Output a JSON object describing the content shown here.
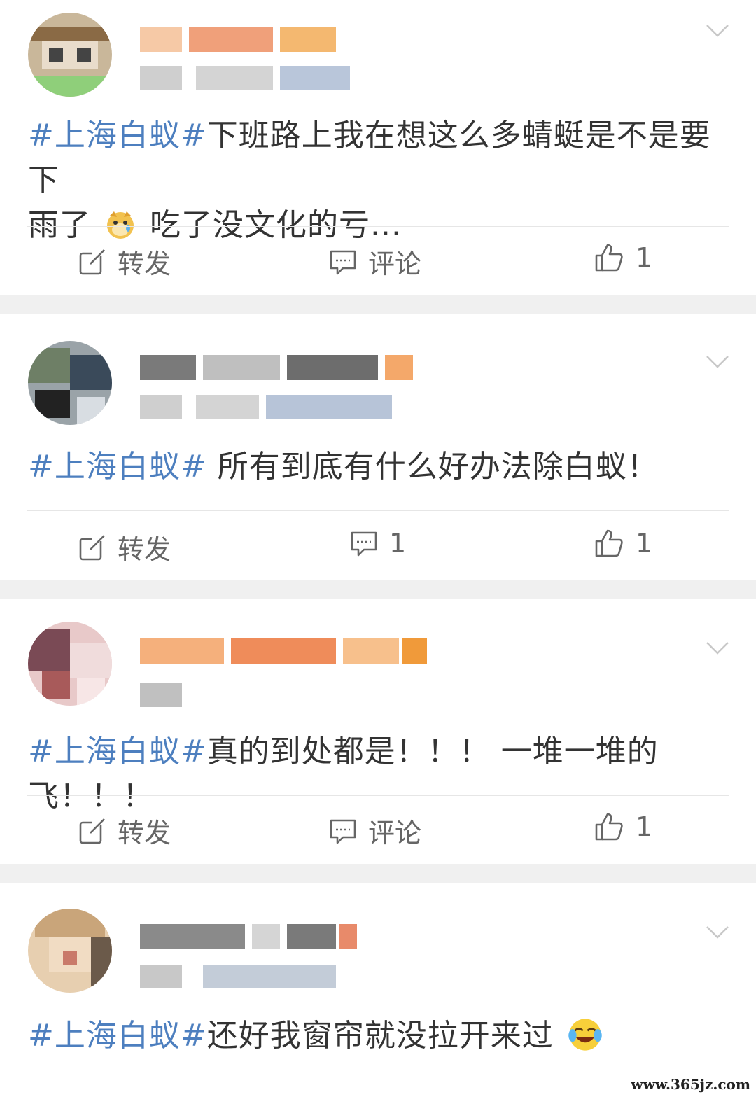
{
  "posts": [
    {
      "topic": "#上海白蚁#",
      "text_line1": "下班路上我在想这么多蜻蜓是不是要下",
      "text_line2_a": "雨了",
      "text_line2_b": "吃了没文化的亏...",
      "emoji": "crying-doge-emoji",
      "repost_label": "转发",
      "comment_label": "评论",
      "like_count": "1"
    },
    {
      "topic": "#上海白蚁#",
      "text": " 所有到底有什么好办法除白蚁！",
      "repost_label": "转发",
      "comment_label": "1",
      "like_count": "1"
    },
    {
      "topic": "#上海白蚁#",
      "text": "真的到处都是！！！  一堆一堆的飞！！！",
      "repost_label": "转发",
      "comment_label": "评论",
      "like_count": "1"
    },
    {
      "topic": "#上海白蚁#",
      "text": "还好我窗帘就没拉开来过",
      "emoji": "laughing-crying-emoji"
    }
  ],
  "watermark": "www.365jz.com",
  "colors": {
    "topic": "#4d7fbf",
    "separator": "#f0f0f0",
    "action_text": "#666666"
  },
  "icons": [
    "chevron-down-icon",
    "repost-icon",
    "comment-icon",
    "like-icon"
  ]
}
